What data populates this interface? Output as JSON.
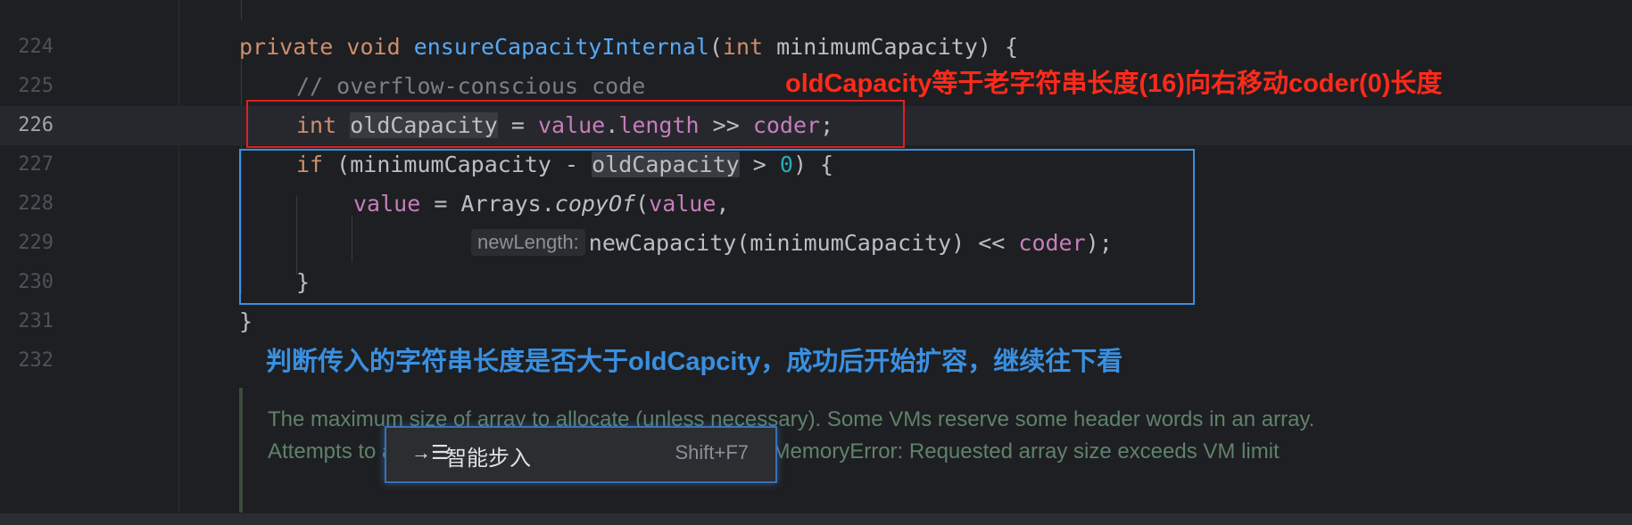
{
  "editor": {
    "lines": [
      {
        "no": "224"
      },
      {
        "no": "225"
      },
      {
        "no": "226"
      },
      {
        "no": "227"
      },
      {
        "no": "228"
      },
      {
        "no": "229"
      },
      {
        "no": "230"
      },
      {
        "no": "231"
      },
      {
        "no": "232"
      }
    ],
    "code": {
      "l224": {
        "private": "private",
        "void": "void",
        "name": "ensureCapacityInternal",
        "p1": "(",
        "int": "int",
        "param": " minimumCapacity) {"
      },
      "l225": {
        "comment": "// overflow-conscious code"
      },
      "l226": {
        "int": "int",
        "var": "oldCapacity",
        "eq": " = ",
        "value": "value",
        "dot": ".",
        "length": "length",
        "shift": " >> ",
        "coder": "coder",
        "semi": ";"
      },
      "l227": {
        "if": "if",
        "p": " (minimumCapacity - ",
        "var": "oldCapacity",
        "gt": " > ",
        "zero": "0",
        "close": ") {"
      },
      "l228": {
        "value": "value",
        "eq": " = Arrays.",
        "copyOf": "copyOf",
        "p": "(",
        "value2": "value",
        "comma": ","
      },
      "l229": {
        "hint": "newLength:",
        "call": "newCapacity(minimumCapacity) << ",
        "coder": "coder",
        "end": ");"
      },
      "l230": {
        "brace": "}"
      },
      "l231": {
        "brace": "}"
      }
    }
  },
  "annotations": {
    "red_note": "oldCapacity等于老字符串长度(16)向右移动coder(0)长度",
    "blue_note": "判断传入的字符串长度是否大于oldCapcity，成功后开始扩容，继续往下看"
  },
  "doc_comment": {
    "text": "The maximum size of array to allocate (unless necessary). Some VMs reserve some header words in an array. Attempts to allocate larger arrays may result in OutOfMemoryError: Requested array size exceeds VM limit"
  },
  "context_popup": {
    "icon": "step-into-icon",
    "label": "智能步入",
    "shortcut": "Shift+F7"
  },
  "colors": {
    "background": "#1e1f22",
    "keyword": "#cf8e6d",
    "method": "#56a8f5",
    "field": "#c77dbb",
    "number": "#2aacb8",
    "comment": "#7a7e85",
    "annotation_red": "#ff2a1a",
    "annotation_blue": "#3a8fe0"
  }
}
